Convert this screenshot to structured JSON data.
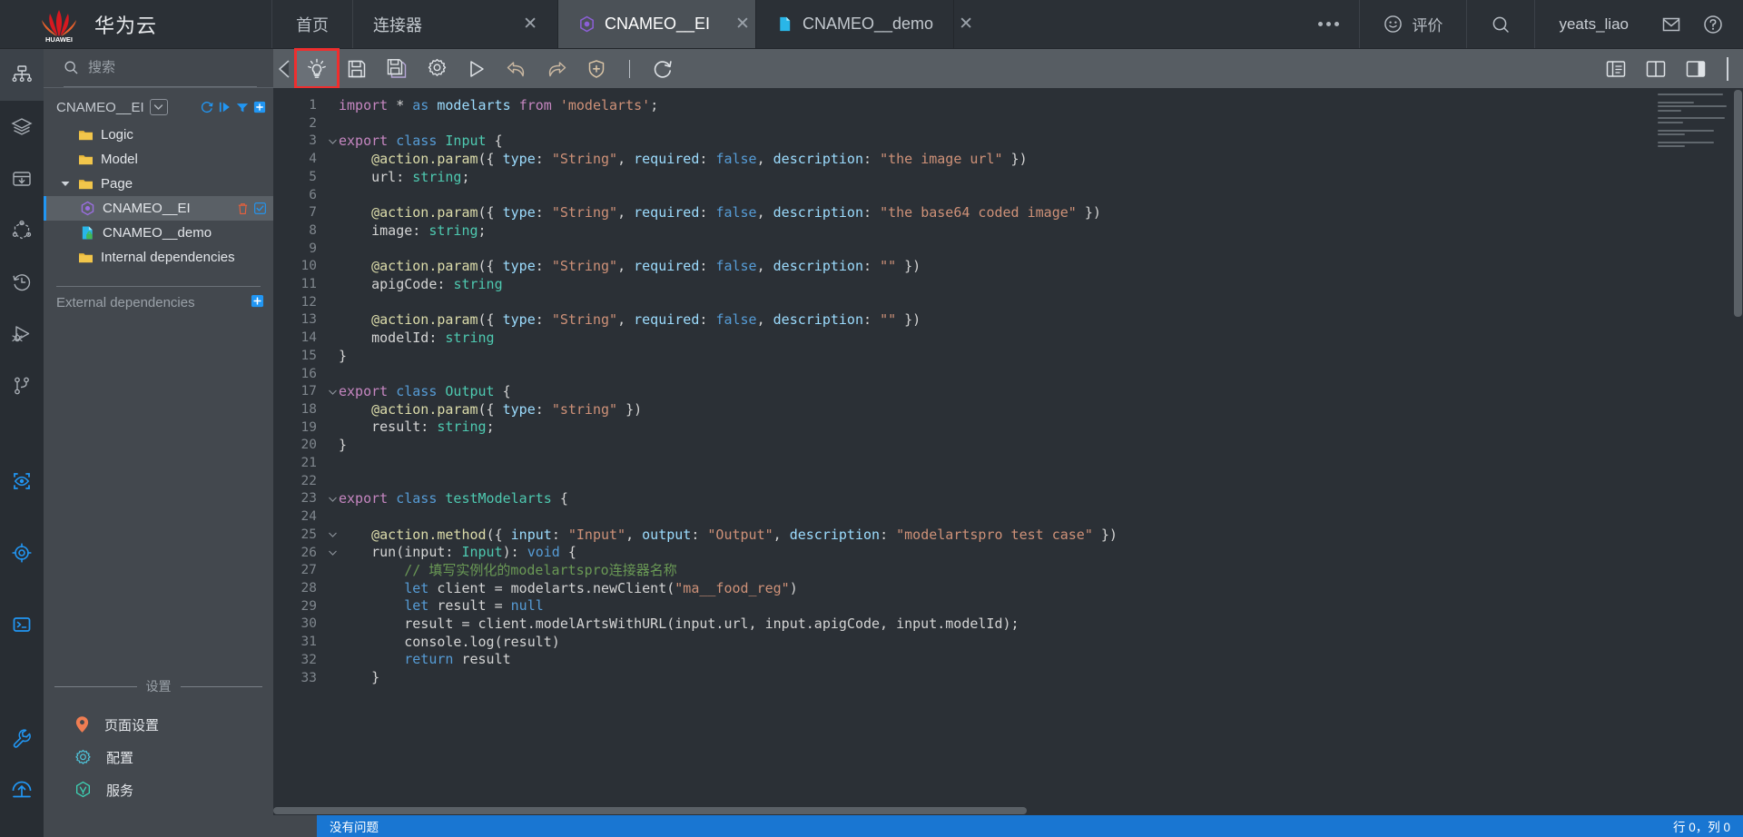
{
  "topbar": {
    "brand": "华为云",
    "logo_alt": "huawei-logo",
    "home": "首页",
    "tabs": [
      {
        "label": "连接器",
        "icon": "none",
        "active": false,
        "close": "✕"
      },
      {
        "label": "CNAMEO__EI",
        "icon": "hexagon-purple",
        "active": true,
        "close": "✕"
      },
      {
        "label": "CNAMEO__demo",
        "icon": "file-blue",
        "active": false,
        "close": "✕"
      }
    ],
    "overflow_icon": "ellipsis-icon",
    "rate_label": "评价",
    "rate_icon": "smiley-icon",
    "search_icon": "search-icon",
    "user": "yeats_liao",
    "mail_icon": "mail-icon",
    "help_icon": "help-icon"
  },
  "rail": {
    "items": [
      {
        "name": "sitemap-icon",
        "active": true
      },
      {
        "name": "layers-icon",
        "active": false
      },
      {
        "name": "package-download-icon",
        "active": false
      },
      {
        "name": "connector-nodes-icon",
        "active": false
      },
      {
        "name": "history-clock-icon",
        "active": false
      },
      {
        "name": "debug-bug-icon",
        "active": false
      },
      {
        "name": "git-branch-icon",
        "active": false
      },
      {
        "name": "preview-eye-icon",
        "active": false
      },
      {
        "name": "target-crosshair-icon",
        "active": false
      },
      {
        "name": "terminal-icon",
        "active": false
      },
      {
        "name": "wrench-icon",
        "active": false
      },
      {
        "name": "deploy-upload-icon",
        "active": false
      }
    ]
  },
  "explorer": {
    "search_placeholder": "搜索",
    "search_value": "",
    "search_icon": "search-icon",
    "tree_title": "CNAMEO__EI",
    "tree_dropdown_icon": "chevron-down-icon",
    "header_actions": [
      "refresh-icon",
      "expand-icon",
      "filter-icon",
      "add-icon"
    ],
    "tree": [
      {
        "label": "Logic",
        "icon": "folder-icon",
        "indent": 0,
        "expanded": false,
        "selected": false,
        "twisty": false
      },
      {
        "label": "Model",
        "icon": "folder-icon",
        "indent": 0,
        "expanded": false,
        "selected": false,
        "twisty": false
      },
      {
        "label": "Page",
        "icon": "folder-icon",
        "indent": 0,
        "expanded": true,
        "selected": false,
        "twisty": true
      },
      {
        "label": "CNAMEO__EI",
        "icon": "hexagon-purple-icon",
        "indent": 1,
        "selected": true,
        "twisty": false,
        "actions": [
          "delete-icon",
          "edit-icon"
        ]
      },
      {
        "label": "CNAMEO__demo",
        "icon": "file-lock-icon",
        "indent": 1,
        "selected": false,
        "twisty": false
      },
      {
        "label": "Internal dependencies",
        "icon": "folder-icon",
        "indent": 0,
        "selected": false,
        "twisty": false
      }
    ],
    "external_dependencies": "External dependencies",
    "external_add_icon": "plus-icon",
    "settings_label": "设置",
    "settings_items": [
      {
        "label": "页面设置",
        "icon": "location-pin-icon",
        "color": "#ef7d52"
      },
      {
        "label": "配置",
        "icon": "gear-icon",
        "color": "#4fc3d9"
      },
      {
        "label": "服务",
        "icon": "hexagon-service-icon",
        "color": "#3ecfb2"
      }
    ]
  },
  "editor_toolbar": {
    "collapse_icon": "collapse-left-icon",
    "buttons": [
      {
        "name": "lightbulb-icon",
        "highlighted": true
      },
      {
        "name": "save-icon",
        "highlighted": false
      },
      {
        "name": "save-all-icon",
        "highlighted": false
      },
      {
        "name": "settings-gear-icon",
        "highlighted": false
      },
      {
        "name": "run-icon",
        "highlighted": false
      },
      {
        "name": "undo-icon",
        "highlighted": false
      },
      {
        "name": "redo-icon",
        "highlighted": false
      },
      {
        "name": "shield-add-icon",
        "highlighted": false
      }
    ],
    "refresh_icon": "refresh-icon",
    "right_buttons": [
      "open-preview-icon",
      "split-editor-icon",
      "toggle-panel-icon"
    ]
  },
  "statusbar": {
    "message": "没有问题",
    "position": "行 0，列 0"
  },
  "code": {
    "first_line": 1,
    "language": "typescript",
    "lines": [
      "import * as modelarts from 'modelarts';",
      "",
      "export class Input {",
      "    @action.param({ type: \"String\", required: false, description: \"the image url\" })",
      "    url: string;",
      "",
      "    @action.param({ type: \"String\", required: false, description: \"the base64 coded image\" })",
      "    image: string;",
      "",
      "    @action.param({ type: \"String\", required: false, description: \"\" })",
      "    apigCode: string",
      "",
      "    @action.param({ type: \"String\", required: false, description: \"\" })",
      "    modelId: string",
      "}",
      "",
      "export class Output {",
      "    @action.param({ type: \"string\" })",
      "    result: string;",
      "}",
      "",
      "",
      "export class testModelarts {",
      "",
      "    @action.method({ input: \"Input\", output: \"Output\", description: \"modelartspro test case\" })",
      "    run(input: Input): void {",
      "        // 填写实例化的modelartspro连接器名称",
      "        let client = modelarts.newClient(\"ma__food_reg\")",
      "        let result = null",
      "        result = client.modelArtsWithURL(input.url, input.apigCode, input.modelId);",
      "        console.log(result)",
      "        return result",
      "    }"
    ],
    "fold_lines": [
      3,
      17,
      23,
      25,
      26
    ]
  }
}
